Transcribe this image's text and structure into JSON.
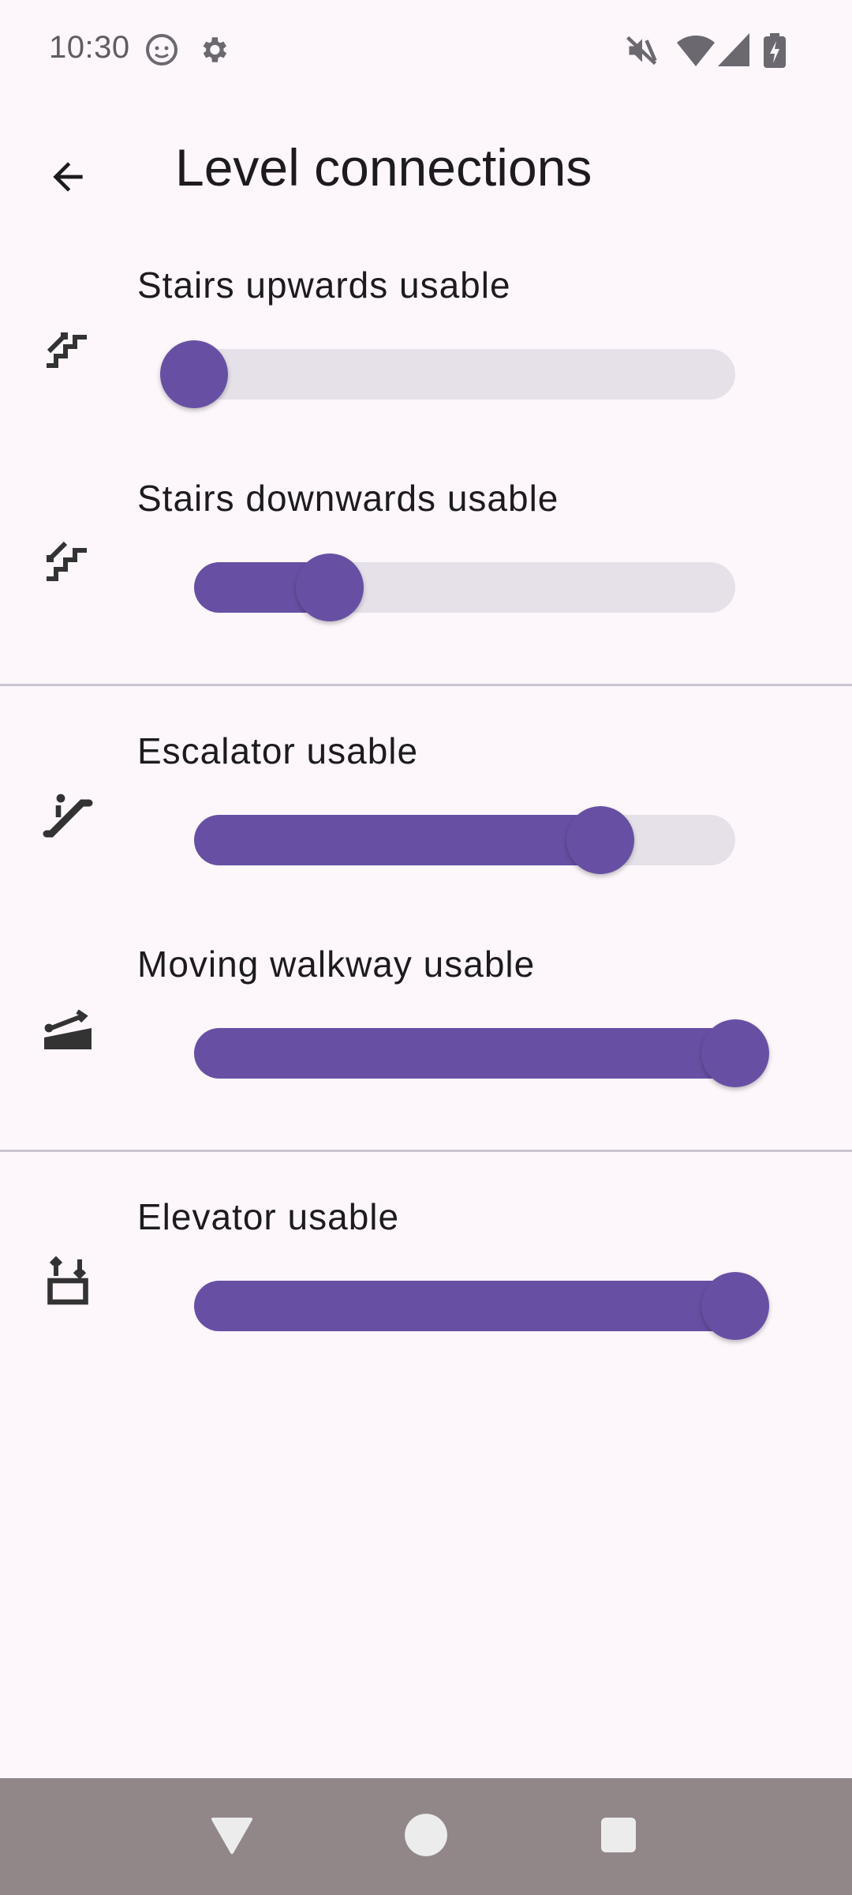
{
  "status_bar": {
    "time": "10:30",
    "icons": [
      "face-icon",
      "gear-icon",
      "mute-icon",
      "wifi-icon",
      "signal-icon",
      "battery-charging-icon"
    ]
  },
  "app_bar": {
    "title": "Level connections",
    "back_icon": "arrow-back-icon"
  },
  "rows": [
    {
      "label": "Stairs upwards usable",
      "icon": "stairs-up-icon",
      "value": 0.0
    },
    {
      "label": "Stairs downwards usable",
      "icon": "stairs-down-icon",
      "value": 0.25
    },
    {
      "label": "Escalator usable",
      "icon": "escalator-icon",
      "value": 0.75
    },
    {
      "label": "Moving walkway usable",
      "icon": "moving-walkway-icon",
      "value": 1.0
    },
    {
      "label": "Elevator usable",
      "icon": "elevator-icon",
      "value": 1.0
    }
  ],
  "colors": {
    "background": "#fdf7fc",
    "accent": "#6750a4",
    "track_inactive": "#e6e0e9",
    "nav_bar": "#918789"
  },
  "nav_bar": {
    "buttons": [
      "back-triangle-icon",
      "home-circle-icon",
      "recents-square-icon"
    ]
  }
}
